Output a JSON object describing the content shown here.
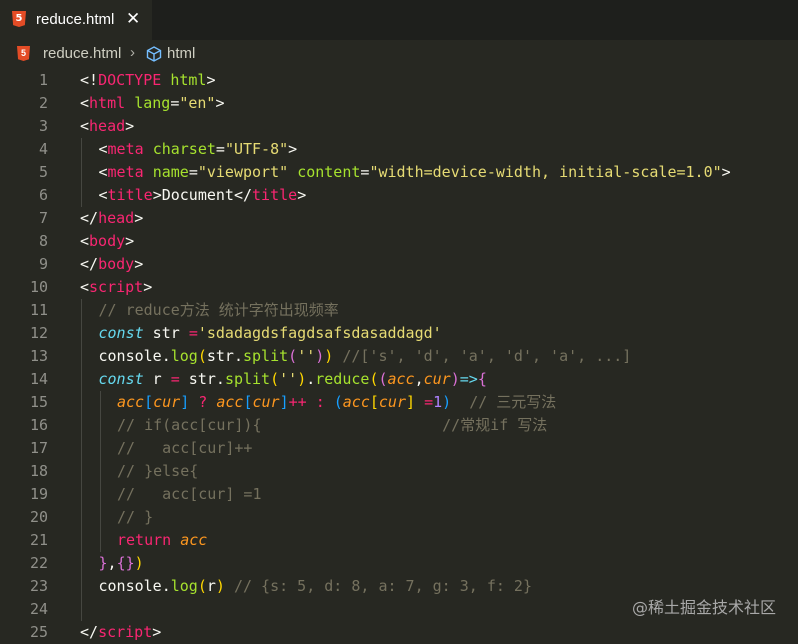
{
  "tab": {
    "title": "reduce.html",
    "close_glyph": "✕",
    "icon": "html5-icon"
  },
  "breadcrumb": {
    "file": "reduce.html",
    "separator": "›",
    "element_icon": "cube-icon",
    "element": "html"
  },
  "lines": [
    {
      "no": "1",
      "indent": 0,
      "tokens": [
        [
          "p",
          "<!"
        ],
        [
          "t",
          "DOCTYPE"
        ],
        [
          "p",
          " "
        ],
        [
          "a",
          "html"
        ],
        [
          "p",
          ">"
        ]
      ]
    },
    {
      "no": "2",
      "indent": 0,
      "tokens": [
        [
          "p",
          "<"
        ],
        [
          "t",
          "html"
        ],
        [
          "p",
          " "
        ],
        [
          "a",
          "lang"
        ],
        [
          "p",
          "="
        ],
        [
          "s",
          "\"en\""
        ],
        [
          "p",
          ">"
        ]
      ]
    },
    {
      "no": "3",
      "indent": 0,
      "tokens": [
        [
          "p",
          "<"
        ],
        [
          "t",
          "head"
        ],
        [
          "p",
          ">"
        ]
      ]
    },
    {
      "no": "4",
      "indent": 1,
      "tokens": [
        [
          "p",
          "<"
        ],
        [
          "t",
          "meta"
        ],
        [
          "p",
          " "
        ],
        [
          "a",
          "charset"
        ],
        [
          "p",
          "="
        ],
        [
          "s",
          "\"UTF-8\""
        ],
        [
          "p",
          ">"
        ]
      ]
    },
    {
      "no": "5",
      "indent": 1,
      "tokens": [
        [
          "p",
          "<"
        ],
        [
          "t",
          "meta"
        ],
        [
          "p",
          " "
        ],
        [
          "a",
          "name"
        ],
        [
          "p",
          "="
        ],
        [
          "s",
          "\"viewport\""
        ],
        [
          "p",
          " "
        ],
        [
          "a",
          "content"
        ],
        [
          "p",
          "="
        ],
        [
          "s",
          "\"width=device-width, initial-scale=1.0\""
        ],
        [
          "p",
          ">"
        ]
      ]
    },
    {
      "no": "6",
      "indent": 1,
      "tokens": [
        [
          "p",
          "<"
        ],
        [
          "t",
          "title"
        ],
        [
          "p",
          ">Document</"
        ],
        [
          "t",
          "title"
        ],
        [
          "p",
          ">"
        ]
      ]
    },
    {
      "no": "7",
      "indent": 0,
      "tokens": [
        [
          "p",
          "</"
        ],
        [
          "t",
          "head"
        ],
        [
          "p",
          ">"
        ]
      ]
    },
    {
      "no": "8",
      "indent": 0,
      "tokens": [
        [
          "p",
          "<"
        ],
        [
          "t",
          "body"
        ],
        [
          "p",
          ">"
        ]
      ]
    },
    {
      "no": "9",
      "indent": 0,
      "tokens": [
        [
          "p",
          "</"
        ],
        [
          "t",
          "body"
        ],
        [
          "p",
          ">"
        ]
      ]
    },
    {
      "no": "10",
      "indent": 0,
      "tokens": [
        [
          "p",
          "<"
        ],
        [
          "t",
          "script"
        ],
        [
          "p",
          ">"
        ]
      ]
    },
    {
      "no": "11",
      "indent": 1,
      "tokens": [
        [
          "c",
          "// reduce方法 统计字符出现频率"
        ]
      ]
    },
    {
      "no": "12",
      "indent": 1,
      "tokens": [
        [
          "k",
          "const"
        ],
        [
          "p",
          " str "
        ],
        [
          "t",
          "="
        ],
        [
          "s",
          "'sdadagdsfagdsafsdasaddagd'"
        ]
      ]
    },
    {
      "no": "13",
      "indent": 1,
      "tokens": [
        [
          "p",
          "console."
        ],
        [
          "a",
          "log"
        ],
        [
          "b1",
          "("
        ],
        [
          "p",
          "str."
        ],
        [
          "a",
          "split"
        ],
        [
          "b2",
          "("
        ],
        [
          "s",
          "''"
        ],
        [
          "b2",
          ")"
        ],
        [
          "b1",
          ")"
        ],
        [
          "p",
          " "
        ],
        [
          "c",
          "//['s', 'd', 'a', 'd', 'a', ...]"
        ]
      ]
    },
    {
      "no": "14",
      "indent": 1,
      "tokens": [
        [
          "k",
          "const"
        ],
        [
          "p",
          " r "
        ],
        [
          "t",
          "="
        ],
        [
          "p",
          " str."
        ],
        [
          "a",
          "split"
        ],
        [
          "b1",
          "("
        ],
        [
          "s",
          "''"
        ],
        [
          "b1",
          ")"
        ],
        [
          "p",
          "."
        ],
        [
          "a",
          "reduce"
        ],
        [
          "b1",
          "("
        ],
        [
          "b2",
          "("
        ],
        [
          "pa",
          "acc"
        ],
        [
          "p",
          ","
        ],
        [
          "pa",
          "cur"
        ],
        [
          "b2",
          ")"
        ],
        [
          "k",
          "=>"
        ],
        [
          "b2",
          "{"
        ]
      ]
    },
    {
      "no": "15",
      "indent": 2,
      "tokens": [
        [
          "pa",
          "acc"
        ],
        [
          "b3",
          "["
        ],
        [
          "pa",
          "cur"
        ],
        [
          "b3",
          "]"
        ],
        [
          "p",
          " "
        ],
        [
          "t",
          "?"
        ],
        [
          "p",
          " "
        ],
        [
          "pa",
          "acc"
        ],
        [
          "b3",
          "["
        ],
        [
          "pa",
          "cur"
        ],
        [
          "b3",
          "]"
        ],
        [
          "t",
          "++"
        ],
        [
          "p",
          " "
        ],
        [
          "t",
          ":"
        ],
        [
          "p",
          " "
        ],
        [
          "b3",
          "("
        ],
        [
          "pa",
          "acc"
        ],
        [
          "b1",
          "["
        ],
        [
          "pa",
          "cur"
        ],
        [
          "b1",
          "]"
        ],
        [
          "p",
          " "
        ],
        [
          "t",
          "="
        ],
        [
          "n",
          "1"
        ],
        [
          "b3",
          ")"
        ],
        [
          "p",
          "  "
        ],
        [
          "c",
          "// 三元写法"
        ]
      ]
    },
    {
      "no": "16",
      "indent": 2,
      "tokens": [
        [
          "c",
          "// if(acc[cur]){                    //常规if 写法"
        ]
      ]
    },
    {
      "no": "17",
      "indent": 2,
      "tokens": [
        [
          "c",
          "//   acc[cur]++"
        ]
      ]
    },
    {
      "no": "18",
      "indent": 2,
      "tokens": [
        [
          "c",
          "// }else{"
        ]
      ]
    },
    {
      "no": "19",
      "indent": 2,
      "tokens": [
        [
          "c",
          "//   acc[cur] =1"
        ]
      ]
    },
    {
      "no": "20",
      "indent": 2,
      "tokens": [
        [
          "c",
          "// }"
        ]
      ]
    },
    {
      "no": "21",
      "indent": 2,
      "tokens": [
        [
          "t",
          "return"
        ],
        [
          "p",
          " "
        ],
        [
          "pa",
          "acc"
        ]
      ]
    },
    {
      "no": "22",
      "indent": 1,
      "tokens": [
        [
          "b2",
          "}"
        ],
        [
          "p",
          ","
        ],
        [
          "b2",
          "{}"
        ],
        [
          "b1",
          ")"
        ]
      ]
    },
    {
      "no": "23",
      "indent": 1,
      "tokens": [
        [
          "p",
          "console."
        ],
        [
          "a",
          "log"
        ],
        [
          "b1",
          "("
        ],
        [
          "p",
          "r"
        ],
        [
          "b1",
          ")"
        ],
        [
          "p",
          " "
        ],
        [
          "c",
          "// {s: 5, d: 8, a: 7, g: 3, f: 2}"
        ]
      ]
    },
    {
      "no": "24",
      "indent": 1,
      "tokens": []
    },
    {
      "no": "25",
      "indent": 0,
      "tokens": [
        [
          "p",
          "</"
        ],
        [
          "t",
          "script"
        ],
        [
          "p",
          ">"
        ]
      ]
    }
  ],
  "watermark": "@稀土掘金技术社区"
}
